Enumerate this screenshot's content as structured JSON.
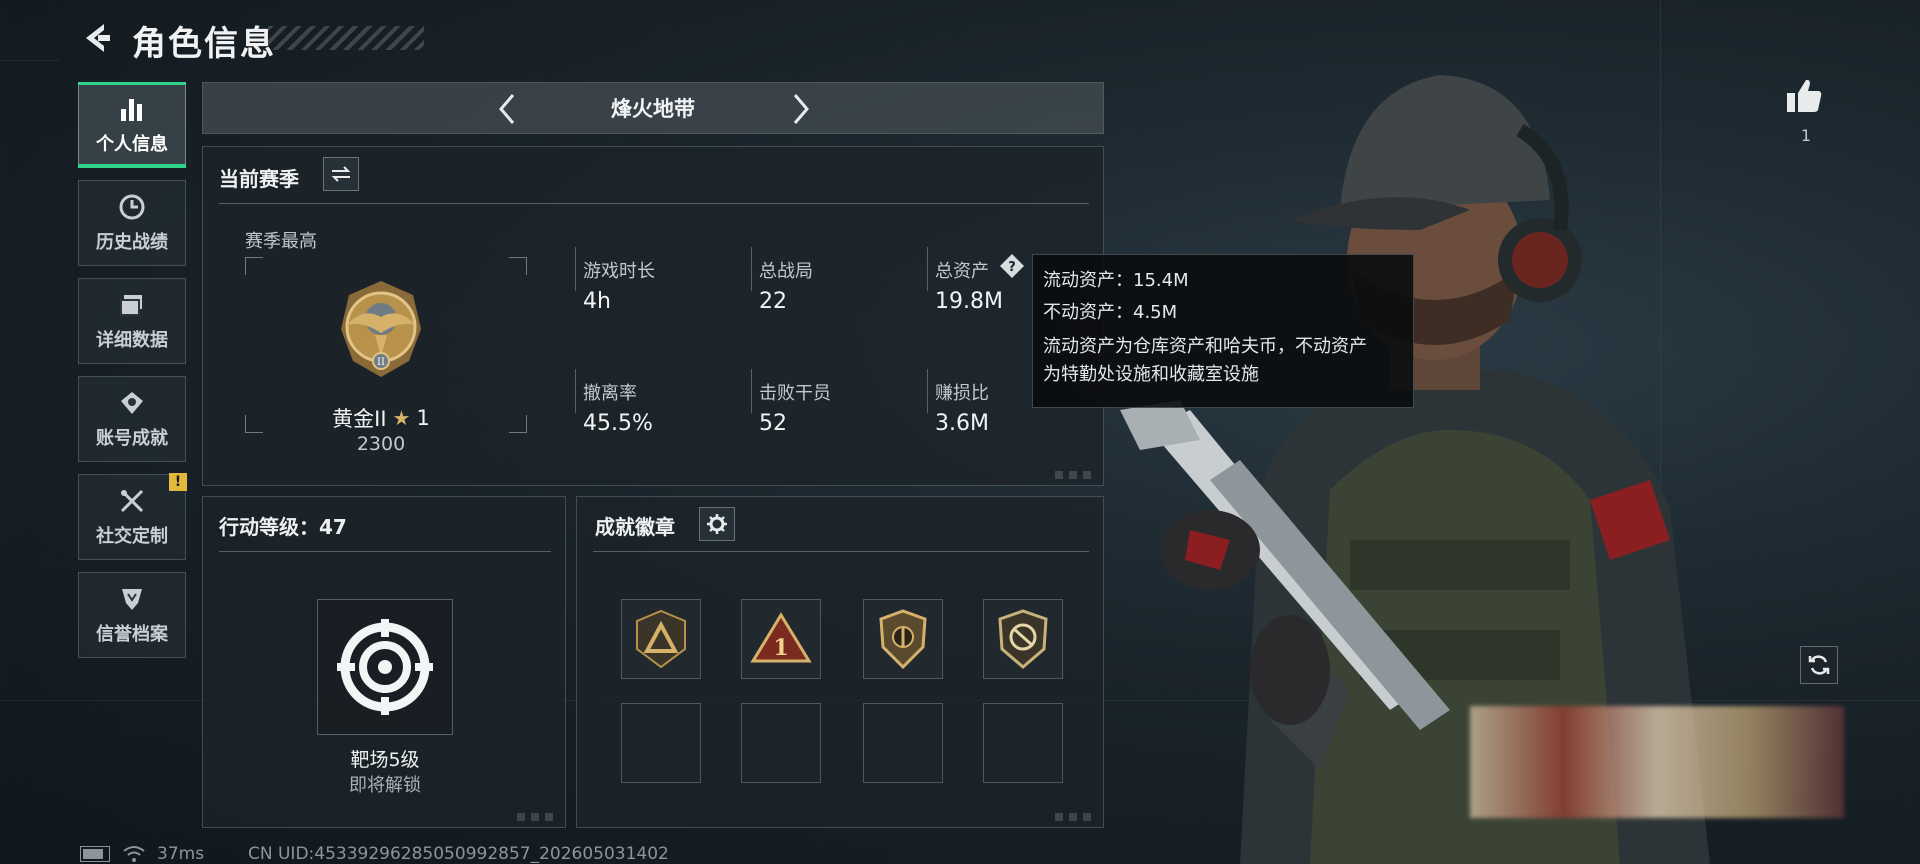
{
  "header": {
    "title": "角色信息"
  },
  "sidebar": {
    "items": [
      {
        "label": "个人信息",
        "icon": "bar-chart-icon"
      },
      {
        "label": "历史战绩",
        "icon": "clock-icon"
      },
      {
        "label": "详细数据",
        "icon": "folder-icon"
      },
      {
        "label": "账号成就",
        "icon": "medal-icon"
      },
      {
        "label": "社交定制",
        "icon": "tools-icon",
        "badge": "!"
      },
      {
        "label": "信誉档案",
        "icon": "shield-icon"
      }
    ]
  },
  "mode": {
    "title": "烽火地带"
  },
  "season": {
    "title": "当前赛季",
    "best_label": "赛季最高",
    "rank_name": "黄金II",
    "rank_star": "★",
    "rank_stars": "1",
    "rank_points": "2300",
    "stats": [
      {
        "label": "游戏时长",
        "value": "4h"
      },
      {
        "label": "总战局",
        "value": "22"
      },
      {
        "label": "总资产",
        "value": "19.8M"
      },
      {
        "label": "撤离率",
        "value": "45.5%"
      },
      {
        "label": "击败干员",
        "value": "52"
      },
      {
        "label": "赚损比",
        "value": "3.6M"
      }
    ]
  },
  "tooltip": {
    "liquid": "流动资产：15.4M",
    "fixed": "不动资产：4.5M",
    "note_line1": "流动资产为仓库资产和哈夫币，不动资产",
    "note_line2": "为特勤处设施和收藏室设施"
  },
  "level": {
    "title": "行动等级：47",
    "unlock_name": "靶场5级",
    "unlock_status": "即将解锁"
  },
  "achievements": {
    "title": "成就徽章"
  },
  "likes": {
    "count": "1"
  },
  "status": {
    "ping": "37ms",
    "uid": "CN UID:45339296285050992857_202605031402"
  },
  "colors": {
    "accent": "#2fd38a",
    "warning": "#e4b83a",
    "gold": "#b8914a"
  }
}
